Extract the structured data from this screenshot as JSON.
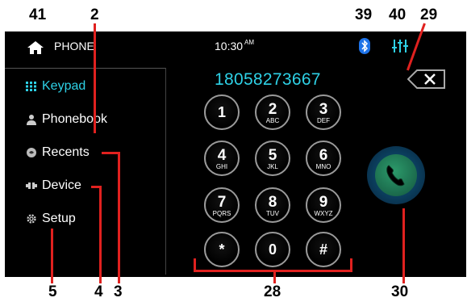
{
  "callouts": {
    "c41": "41",
    "c2": "2",
    "c39": "39",
    "c40": "40",
    "c29": "29",
    "c5": "5",
    "c4": "4",
    "c3": "3",
    "c28": "28",
    "c30": "30"
  },
  "header": {
    "title": "PHONE",
    "time": "10:30",
    "ampm": "AM"
  },
  "sidebar": {
    "items": [
      {
        "label": "Keypad",
        "icon": "keypad-icon",
        "active": true
      },
      {
        "label": "Phonebook",
        "icon": "person-icon"
      },
      {
        "label": "Recents",
        "icon": "recents-icon"
      },
      {
        "label": "Device",
        "icon": "device-icon"
      },
      {
        "label": "Setup",
        "icon": "gear-icon"
      }
    ]
  },
  "dialer": {
    "number": "18058273667",
    "keys": [
      {
        "digit": "1",
        "letters": ""
      },
      {
        "digit": "2",
        "letters": "ABC"
      },
      {
        "digit": "3",
        "letters": "DEF"
      },
      {
        "digit": "4",
        "letters": "GHI"
      },
      {
        "digit": "5",
        "letters": "JKL"
      },
      {
        "digit": "6",
        "letters": "MNO"
      },
      {
        "digit": "7",
        "letters": "PQRS"
      },
      {
        "digit": "8",
        "letters": "TUV"
      },
      {
        "digit": "9",
        "letters": "WXYZ"
      },
      {
        "digit": "*",
        "letters": ""
      },
      {
        "digit": "0",
        "letters": ""
      },
      {
        "digit": "#",
        "letters": ""
      }
    ]
  },
  "colors": {
    "accent": "#2ed1e6",
    "callout_line": "#e0211f",
    "call_button": "#1b6a4c",
    "bluetooth": "#1e73e8"
  }
}
